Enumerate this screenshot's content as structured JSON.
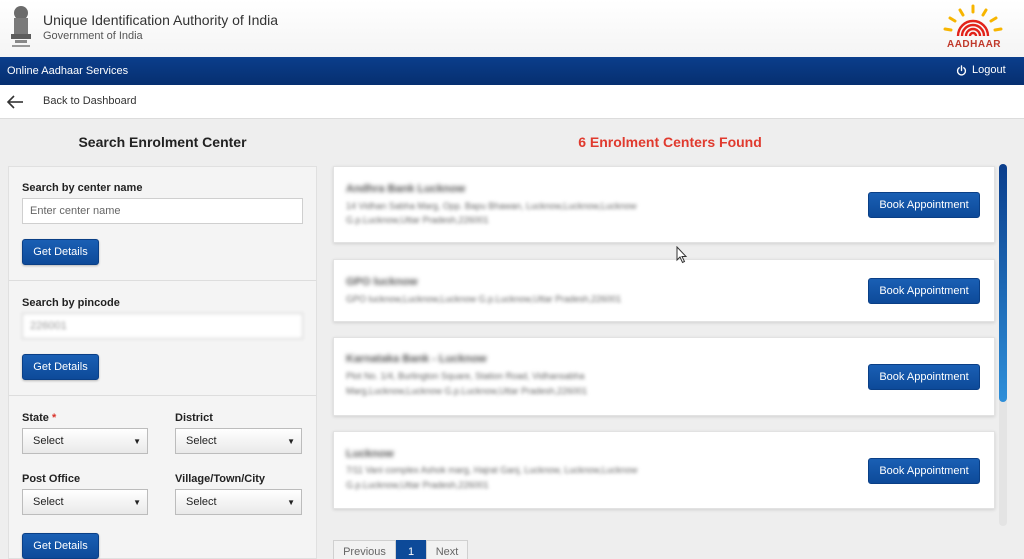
{
  "header": {
    "org_title": "Unique Identification Authority of India",
    "org_subtitle": "Government of India",
    "logo_text": "AADHAAR"
  },
  "nav": {
    "service_title": "Online Aadhaar Services",
    "logout_label": "Logout"
  },
  "backbar": {
    "back_label": "Back to Dashboard"
  },
  "search": {
    "title": "Search Enrolment Center",
    "by_name_label": "Search by center name",
    "name_placeholder": "Enter center name",
    "get_details_label": "Get Details",
    "by_pincode_label": "Search by pincode",
    "pincode_value": "226001",
    "state_label": "State",
    "required_mark": "*",
    "district_label": "District",
    "post_office_label": "Post Office",
    "village_label": "Village/Town/City",
    "select_placeholder": "Select"
  },
  "results": {
    "title": "6 Enrolment Centers Found",
    "book_label": "Book Appointment",
    "centers": [
      {
        "name": "Andhra Bank Lucknow",
        "address_line1": "14 Vidhan Sabha Marg, Opp. Bapu Bhawan, Lucknow,Lucknow,Lucknow",
        "address_line2": "G.p.Lucknow,Uttar Pradesh,226001"
      },
      {
        "name": "GPO lucknow",
        "address_line1": "GPO lucknow,Lucknow,Lucknow G.p.Lucknow,Uttar Pradesh,226001",
        "address_line2": ""
      },
      {
        "name": "Karnataka Bank - Lucknow",
        "address_line1": "Plot No. 1/4, Burlington Square, Station Road, Vidhansabha",
        "address_line2": "Marg,Lucknow,Lucknow G.p.Lucknow,Uttar Pradesh,226001"
      },
      {
        "name": "Lucknow",
        "address_line1": "7/11 Vani complex Ashok marg, Hajrat Ganj, Lucknow, Lucknow,Lucknow",
        "address_line2": "G.p.Lucknow,Uttar Pradesh,226001"
      }
    ]
  },
  "pagination": {
    "previous_label": "Previous",
    "current_page": "1",
    "next_label": "Next"
  },
  "colors": {
    "brand_blue": "#0b3e8c",
    "accent_red": "#e03a2e",
    "button_blue": "#0d4a99"
  }
}
